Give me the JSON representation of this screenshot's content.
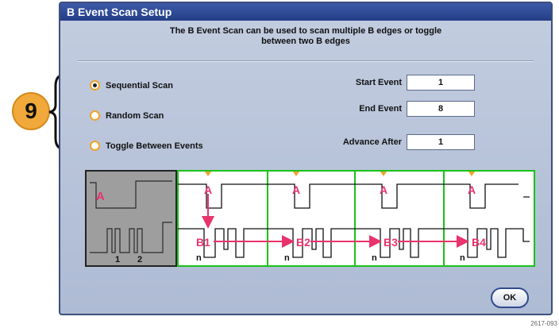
{
  "callout": {
    "number": "9"
  },
  "dialog": {
    "title": "B Event Scan Setup",
    "description_line1": "The B Event Scan can be used to scan multiple B edges or toggle",
    "description_line2": "between two B edges",
    "options": [
      {
        "label": "Sequential Scan",
        "selected": true
      },
      {
        "label": "Random Scan",
        "selected": false
      },
      {
        "label": "Toggle Between Events",
        "selected": false
      }
    ],
    "fields": {
      "start_event": {
        "label": "Start Event",
        "value": "1"
      },
      "end_event": {
        "label": "End Event",
        "value": "8"
      },
      "advance_after": {
        "label": "Advance After",
        "value": "1"
      }
    },
    "ok_label": "OK"
  },
  "waveform": {
    "preview_labels": {
      "a": "A",
      "edge1": "1",
      "edge2": "2"
    },
    "panels": [
      {
        "a": "A",
        "b": "B1",
        "n": "n"
      },
      {
        "a": "A",
        "b": "B2",
        "n": "n"
      },
      {
        "a": "A",
        "b": "B3",
        "n": "n"
      },
      {
        "a": "A",
        "b": "B4",
        "n": "n"
      }
    ]
  },
  "figure_code": "2617-093",
  "colors": {
    "accent": "#f0a22c",
    "titlebar": "#233e86",
    "scope_green": "#19c219",
    "marker_pink": "#e8336d"
  }
}
